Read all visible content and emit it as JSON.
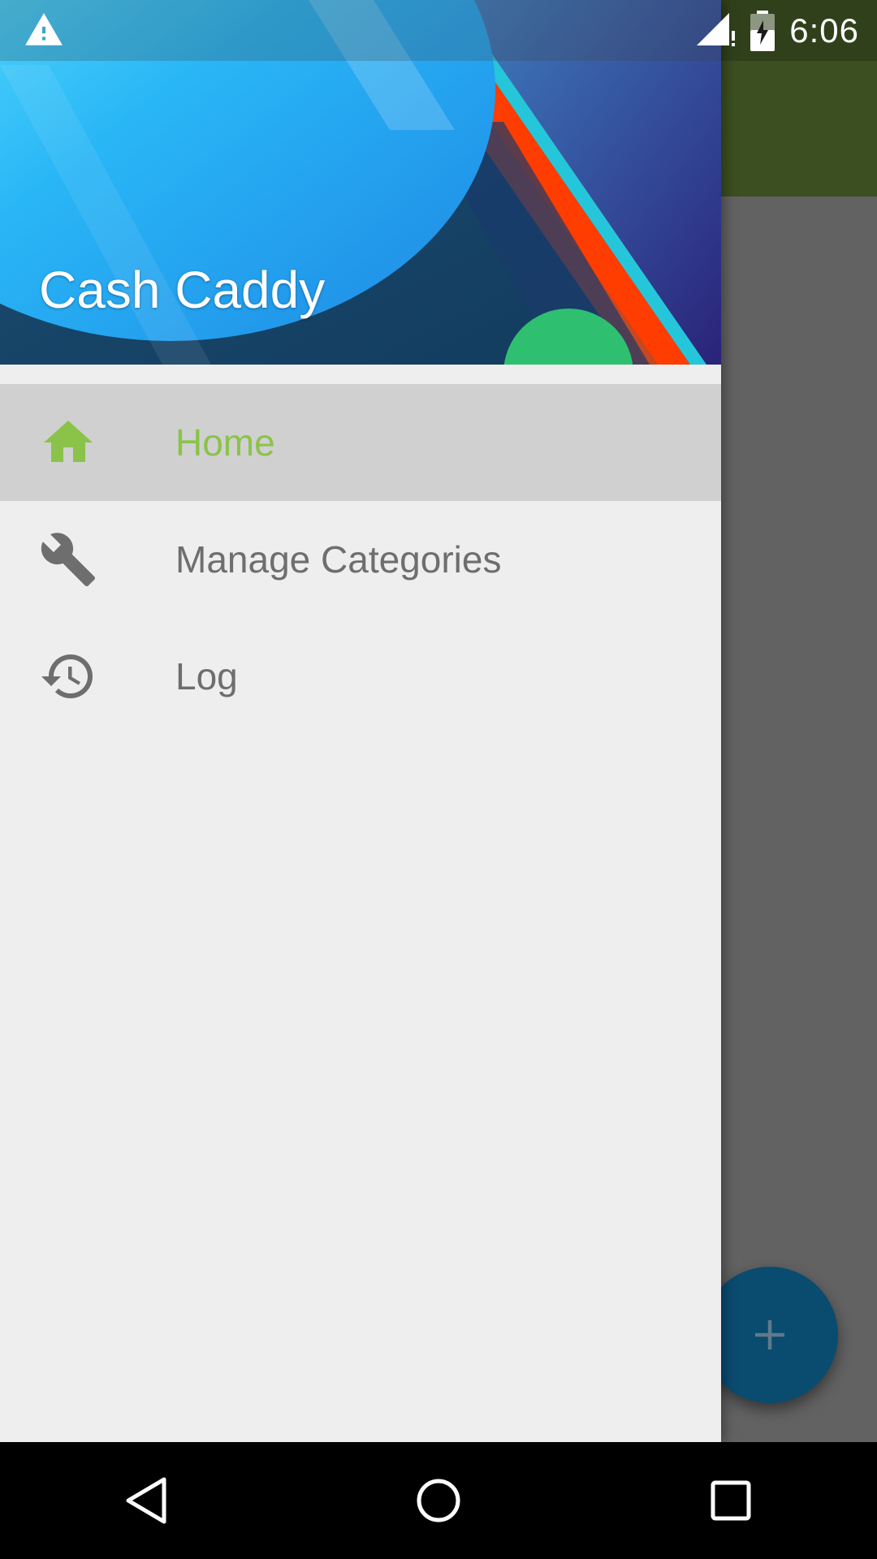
{
  "status_bar": {
    "time": "6:06",
    "icons": [
      "warning-icon",
      "signal-icon",
      "battery-charging-icon"
    ]
  },
  "app": {
    "fab_icon": "plus-icon",
    "colors": {
      "app_bar": "#3b4f21",
      "fab": "#0a4b70"
    }
  },
  "drawer": {
    "header_title": "Cash Caddy",
    "items": [
      {
        "label": "Home",
        "icon": "home-icon",
        "active": true
      },
      {
        "label": "Manage Categories",
        "icon": "wrench-icon",
        "active": false
      },
      {
        "label": "Log",
        "icon": "history-icon",
        "active": false
      }
    ],
    "colors": {
      "accent": "#8bc34a",
      "text": "#6e6e6e",
      "active_bg": "#d0d0d0",
      "bg": "#eeeeee"
    }
  },
  "nav_bar": {
    "buttons": [
      "back-icon",
      "home-circle-icon",
      "recents-icon"
    ]
  }
}
